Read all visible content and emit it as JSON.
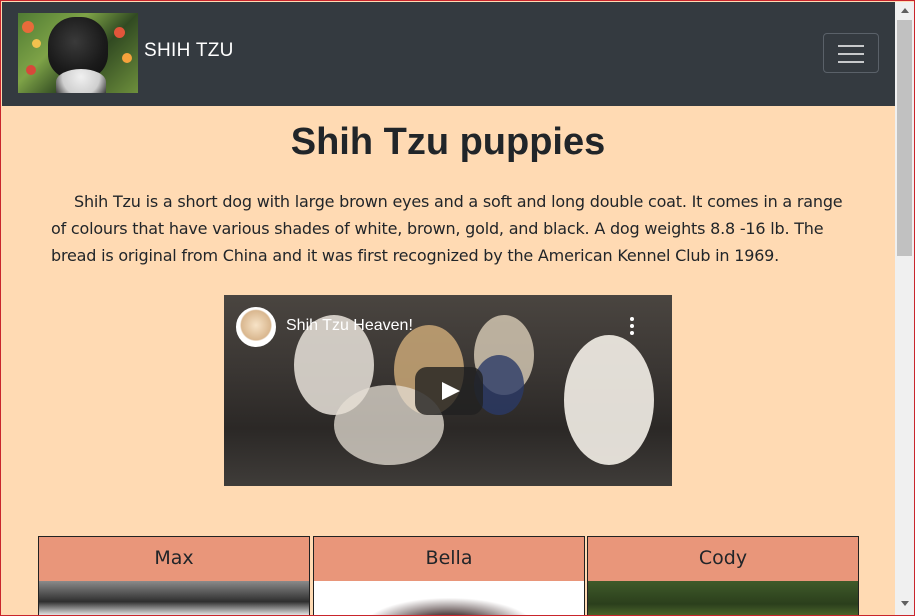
{
  "navbar": {
    "brand_text": "SHIH TZU",
    "background": "#343a40"
  },
  "main": {
    "title": "Shih Tzu puppies",
    "intro": "Shih Tzu is a short dog with large brown eyes and a soft and long double coat. It comes in a range of colours that have various shades of white, brown, gold, and black. A dog weights 8.8 -16 lb. The bread is original from China and it was first recognized by the American Kennel Club in 1969.",
    "background": "#ffdab3"
  },
  "video": {
    "channel_title": "Shih Tzu Heaven!"
  },
  "cards": [
    {
      "name": "Max"
    },
    {
      "name": "Bella"
    },
    {
      "name": "Cody"
    }
  ],
  "colors": {
    "card_header": "#e9967a",
    "page_border": "#c9252c"
  }
}
